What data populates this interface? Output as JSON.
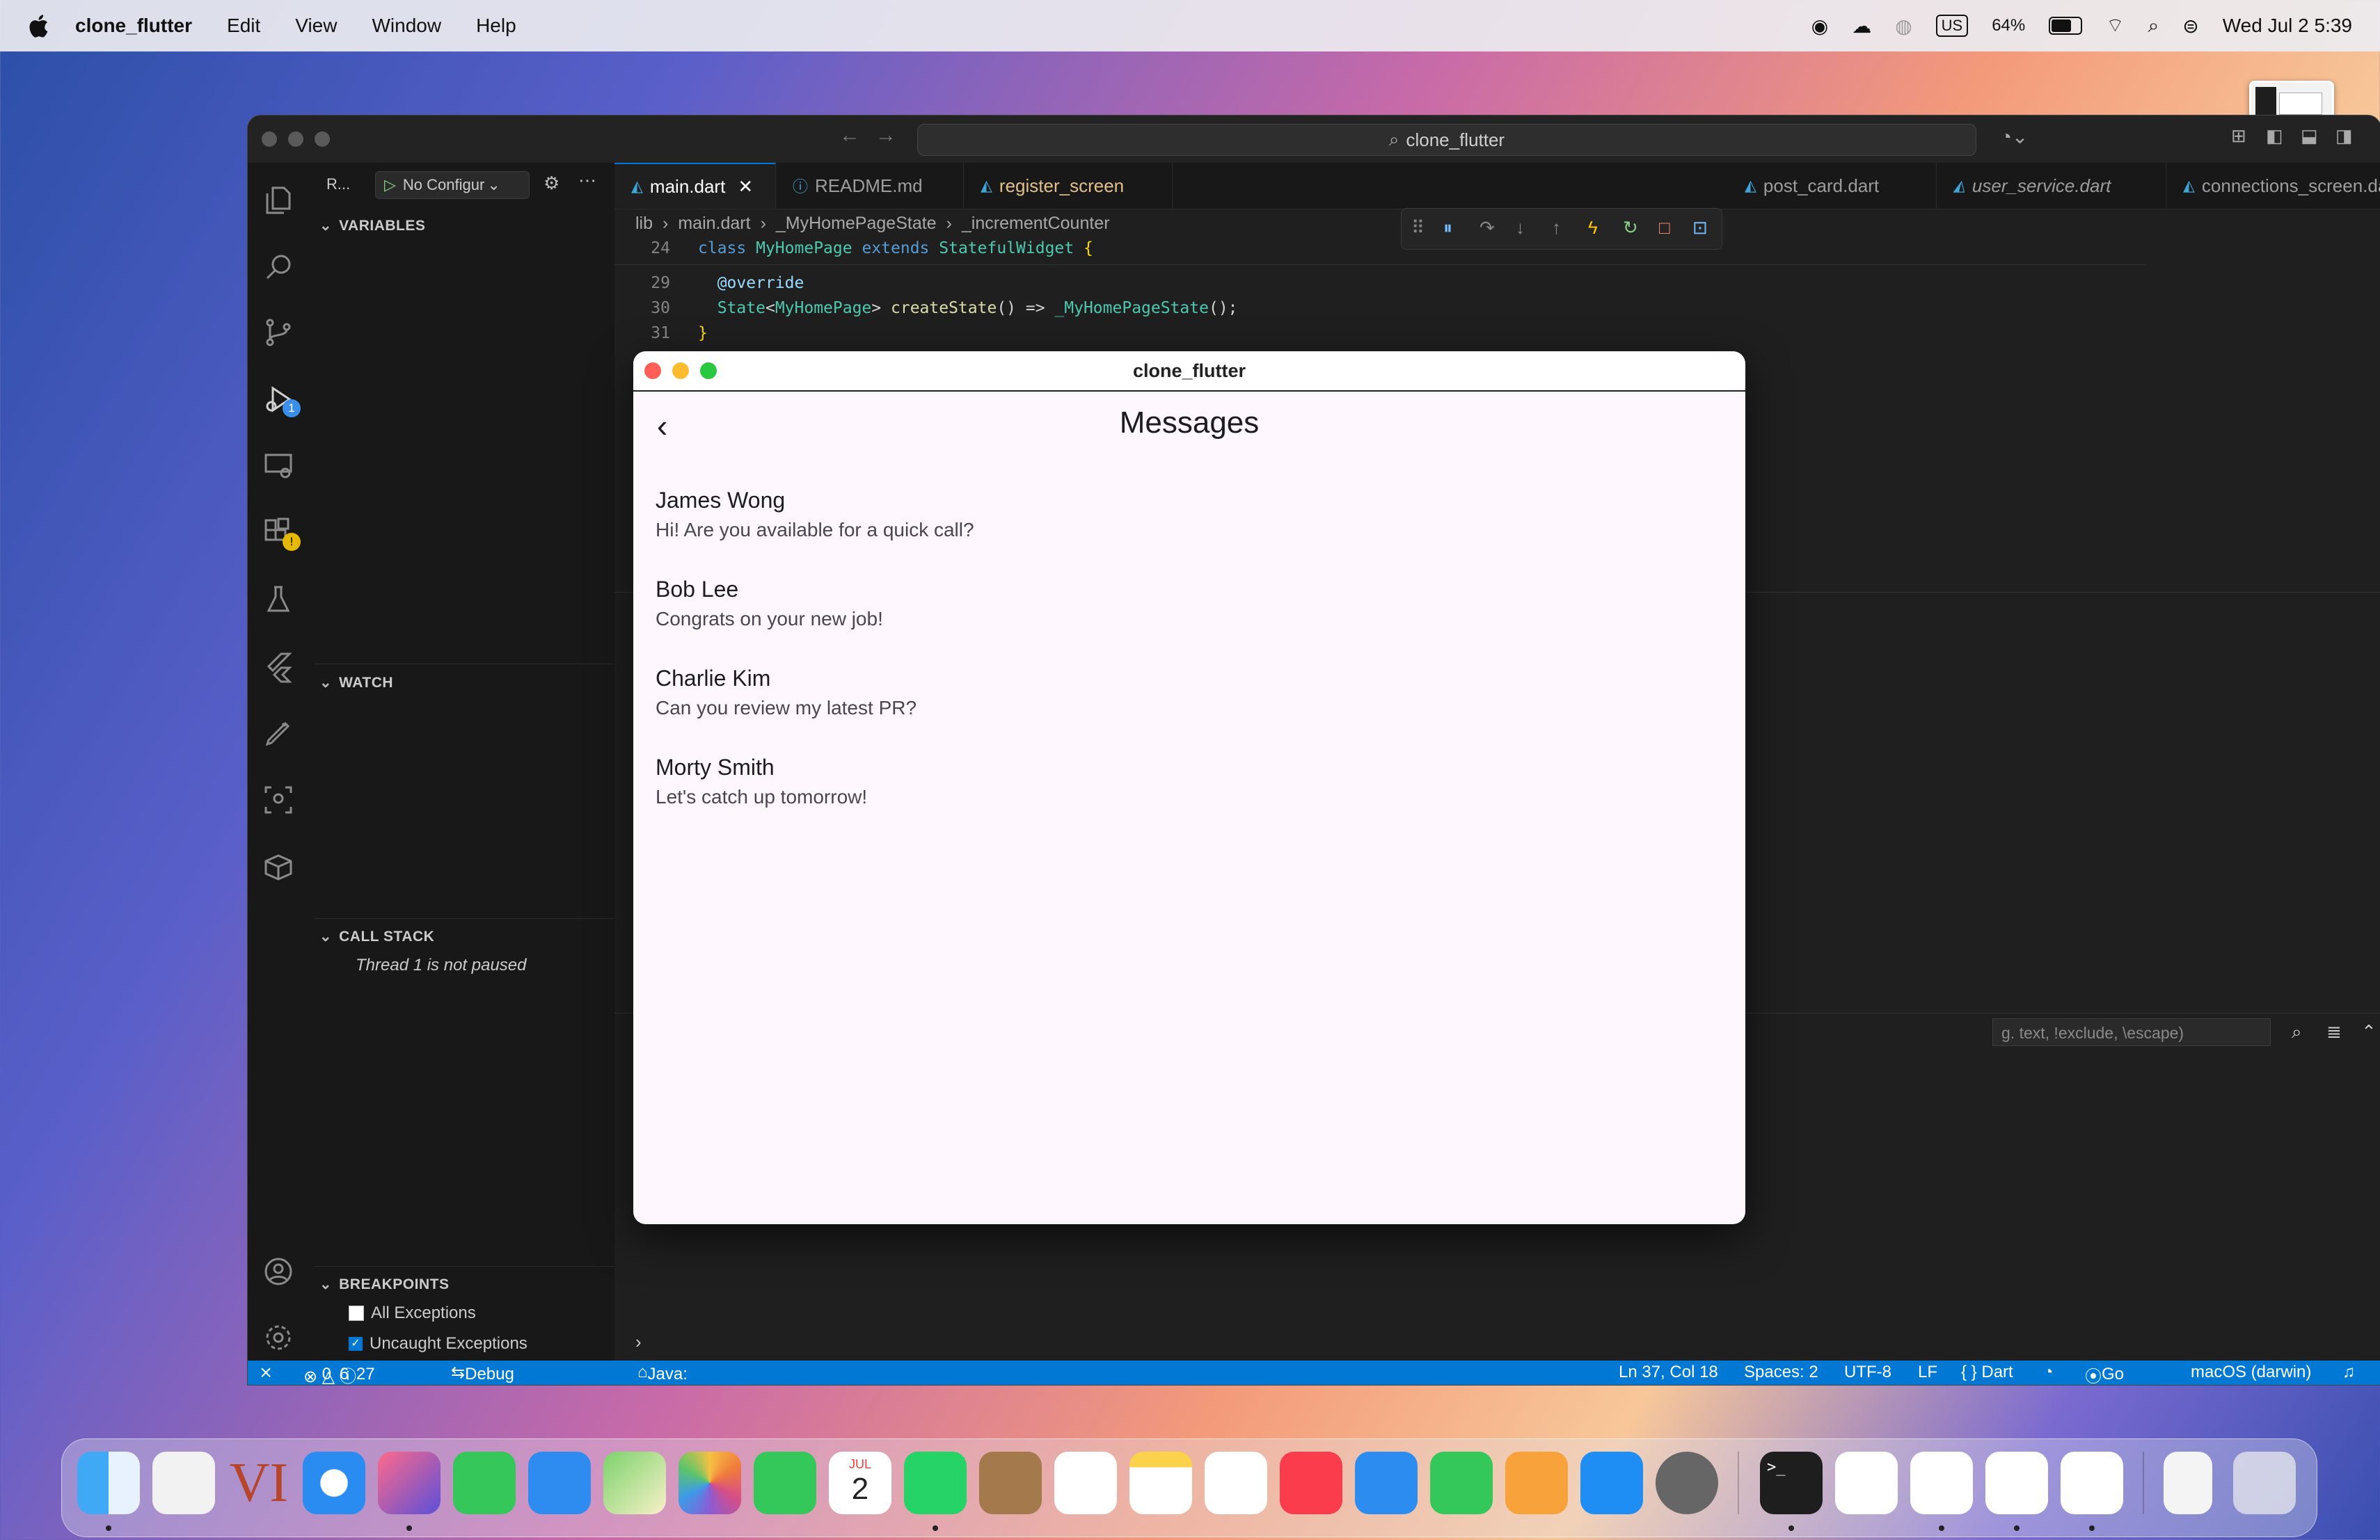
{
  "menubar": {
    "app_name": "clone_flutter",
    "items": [
      "Edit",
      "View",
      "Window",
      "Help"
    ],
    "keyboard": "US",
    "battery": "64%",
    "datetime": "Wed Jul 2  5:39"
  },
  "vscode": {
    "search": "clone_flutter",
    "run_label": "R...",
    "config": "No Configur",
    "sidebar": {
      "variables": "VARIABLES",
      "watch": "WATCH",
      "callstack": "CALL STACK",
      "thread": "Thread 1 is not paused",
      "breakpoints": "BREAKPOINTS",
      "bp_items": [
        "All Exceptions",
        "Uncaught Exceptions"
      ]
    },
    "tabs": [
      "main.dart",
      "README.md",
      "register_screen",
      "post_card.dart",
      "user_service.dart",
      "connections_screen.dart"
    ],
    "breadcrumb": [
      "lib",
      "main.dart",
      "_MyHomePageState",
      "_incrementCounter"
    ],
    "code": [
      {
        "ln": "24",
        "text": "class MyHomePage extends StatefulWidget {"
      },
      {
        "ln": "29",
        "text": "  @override"
      },
      {
        "ln": "30",
        "text": "  State<MyHomePage> createState() => _MyHomePageState();"
      },
      {
        "ln": "31",
        "text": "}"
      }
    ],
    "terminal_filter": "g. text, !exclude, \\escape)",
    "status": {
      "problems": "0 △ 6 ⓘ 27",
      "errors": "0",
      "warnings": "6",
      "infos": "27",
      "debug": "Debug my code",
      "java": "Java: Ready",
      "position": "Ln 37, Col 18",
      "spaces": "Spaces: 2",
      "encoding": "UTF-8",
      "eol": "LF",
      "language": "{ } Dart",
      "golive": "Go Live",
      "platform": "macOS (darwin)"
    }
  },
  "flutter": {
    "window_title": "clone_flutter",
    "screen_title": "Messages",
    "messages": [
      {
        "name": "James Wong",
        "text": "Hi! Are you available for a quick call?"
      },
      {
        "name": "Bob Lee",
        "text": "Congrats on your new job!"
      },
      {
        "name": "Charlie Kim",
        "text": "Can you review my latest PR?"
      },
      {
        "name": "Morty Smith",
        "text": "Let's catch up tomorrow!"
      }
    ]
  },
  "dock": {
    "calendar_month": "JUL",
    "calendar_day": "2",
    "apps": [
      "finder",
      "launchpad",
      "vim",
      "safari",
      "affinity",
      "messages",
      "mail",
      "maps",
      "photos",
      "facetime",
      "calendar",
      "whatsapp",
      "contacts",
      "reminders",
      "notes",
      "freeform",
      "music",
      "keynote",
      "numbers",
      "pages",
      "app-store",
      "system-settings",
      "terminal",
      "xcode",
      "telegram",
      "vscode",
      "flutter",
      "archive",
      "trash"
    ]
  },
  "colors": {
    "accent": "#0078d4",
    "flutter_bg": "#fef7fe"
  }
}
